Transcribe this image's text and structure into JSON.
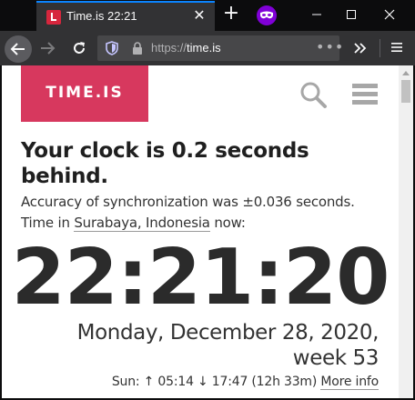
{
  "browser": {
    "tab": {
      "title": "Time.is 22:21"
    },
    "url": {
      "scheme": "https://",
      "host": "time.is",
      "more": "•••"
    }
  },
  "page": {
    "logo_text": "TIME.IS",
    "headline": "Your clock is 0.2 seconds behind.",
    "accuracy": "Accuracy of synchronization was ±0.036 seconds.",
    "time_in_prefix": "Time in ",
    "city": "Surabaya, Indonesia",
    "time_in_suffix": " now:",
    "clock": "22:21:20",
    "date_line1": "Monday, December 28, 2020,",
    "date_line2": "week 53",
    "sun_text": "Sun: ↑ 05:14 ↓ 17:47 (12h 33m) ",
    "more_info": "More info"
  },
  "colors": {
    "accent": "#d7385e",
    "tab_line": "#0a84ff",
    "private": "#8000d7"
  },
  "icons": [
    "favicon-icon",
    "close-icon",
    "plus-icon",
    "private-mask-icon",
    "minimize-icon",
    "maximize-icon",
    "window-close-icon",
    "back-arrow-icon",
    "forward-arrow-icon",
    "reload-icon",
    "shield-icon",
    "lock-icon",
    "overflow-chevrons-icon",
    "hamburger-icon",
    "search-icon",
    "menu-icon"
  ]
}
